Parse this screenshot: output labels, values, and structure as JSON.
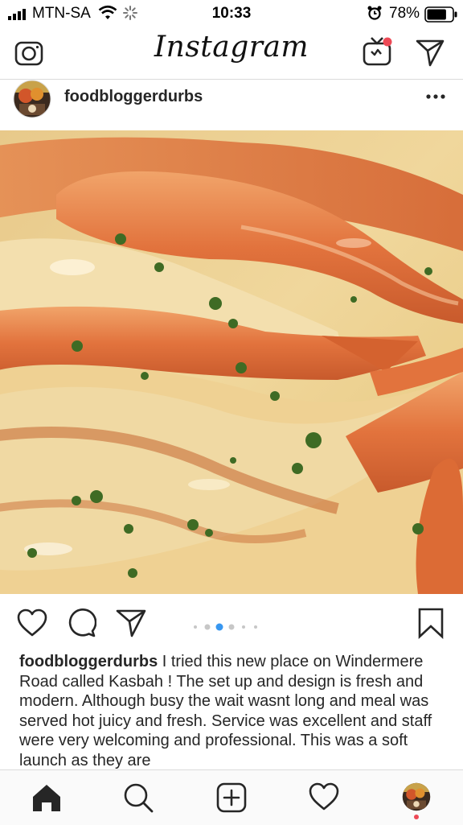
{
  "status_bar": {
    "carrier": "MTN-SA",
    "time": "10:33",
    "battery_percent": "78%",
    "battery_level": 0.78,
    "icons": [
      "signal-bars-icon",
      "wifi-icon",
      "loading-icon",
      "alarm-icon",
      "battery-icon"
    ]
  },
  "top_nav": {
    "logo_text": "Instagram",
    "left_icon": "camera-icon",
    "right_icons": [
      "igtv-icon",
      "direct-message-icon"
    ],
    "notification_color": "#ed4956"
  },
  "post": {
    "username": "foodbloggerdurbs",
    "more_icon": "more-options-icon",
    "image_description_icon": "food-photo",
    "actions": [
      "like-heart-icon",
      "comment-icon",
      "share-icon",
      "save-bookmark-icon"
    ],
    "carousel": {
      "total": 6,
      "active": 3,
      "active_color": "#3897f0"
    },
    "caption_username": "foodbloggerdurbs",
    "caption_text": "I tried this new place on Windermere Road called Kasbah ! The set up and design is fresh and modern. Although busy the wait wasnt long and meal was served hot juicy and fresh. Service was excellent and staff were very welcoming and professional. This was a soft launch as they are"
  },
  "tab_bar": {
    "items": [
      "home-icon",
      "search-icon",
      "new-post-icon",
      "activity-heart-icon",
      "profile-avatar"
    ],
    "active": "home-icon"
  }
}
